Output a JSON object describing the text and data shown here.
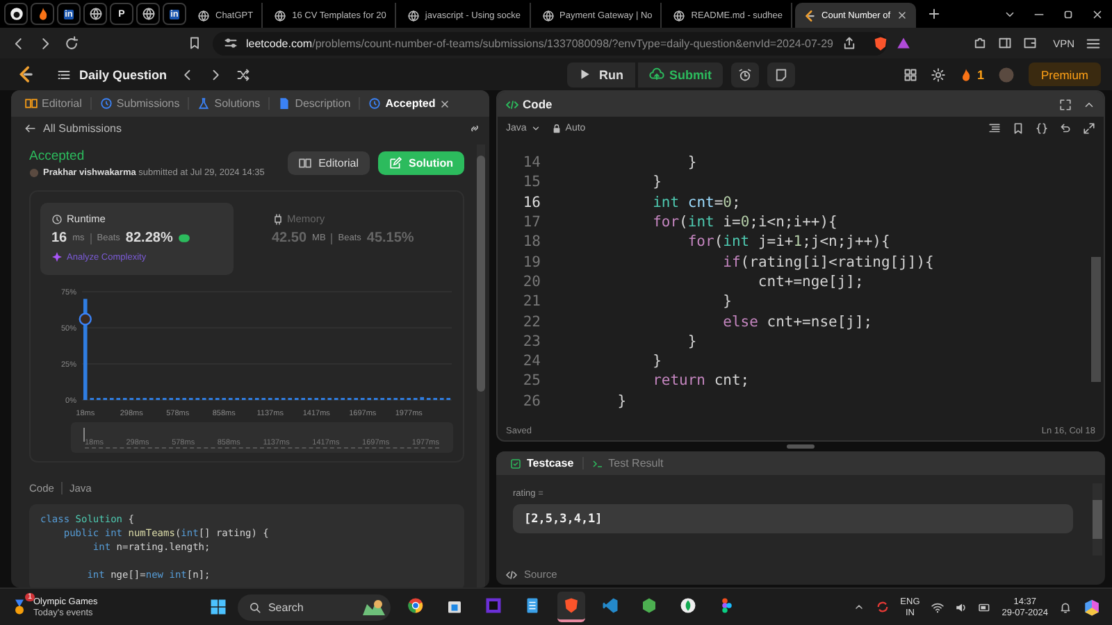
{
  "browser": {
    "pinned_tabs": [
      {
        "kind": "round"
      },
      {
        "kind": "flame"
      },
      {
        "kind": "badge",
        "glyph": "in"
      },
      {
        "kind": "globe"
      },
      {
        "kind": "letter",
        "glyph": "P"
      },
      {
        "kind": "globe"
      },
      {
        "kind": "badge",
        "glyph": "in"
      }
    ],
    "tabs": [
      {
        "title": "ChatGPT",
        "selected": false
      },
      {
        "title": "16 CV Templates for 20",
        "selected": false
      },
      {
        "title": "javascript - Using socke",
        "selected": false
      },
      {
        "title": "Payment Gateway | No",
        "selected": false
      },
      {
        "title": "README.md - sudhee",
        "selected": false
      },
      {
        "title": "Count Number of",
        "selected": true
      }
    ],
    "url": {
      "host": "leetcode.com",
      "path": "/problems/count-number-of-teams/submissions/1337080098/?envType=daily-question&envId=2024-07-29"
    },
    "vpn": "VPN"
  },
  "header": {
    "title": "Daily Question",
    "run": "Run",
    "submit": "Submit",
    "streak": "1",
    "premium": "Premium"
  },
  "left_panel": {
    "tabs": [
      {
        "label": "Editorial",
        "kind": "book",
        "selected": false
      },
      {
        "label": "Submissions",
        "kind": "clock",
        "selected": false
      },
      {
        "label": "Solutions",
        "kind": "flask",
        "selected": false
      },
      {
        "label": "Description",
        "kind": "doc",
        "selected": false
      },
      {
        "label": "Accepted",
        "kind": "clock",
        "selected": true
      }
    ],
    "back_link": "All Submissions",
    "submission": {
      "status": "Accepted",
      "byline": "**Prakhar vishwakarma** submitted at Jul 29, 2024 14:35",
      "editorial_button": "Editorial",
      "solution_button": "Solution"
    },
    "runtime": {
      "selected": true,
      "label": "Runtime",
      "value": "16",
      "unit": "ms",
      "beats_label": "Beats",
      "beats": "82.28%",
      "analyze": "Analyze Complexity"
    },
    "memory": {
      "selected": false,
      "label": "Memory",
      "value": "42.50",
      "unit": "MB",
      "beats_label": "Beats",
      "beats": "45.15%"
    },
    "chart_data": {
      "type": "bar",
      "ylim": [
        0,
        75
      ],
      "yticks": [
        {
          "value": 0,
          "label": "0%"
        },
        {
          "value": 25,
          "label": "25%"
        },
        {
          "value": 50,
          "label": "50%"
        },
        {
          "value": 75,
          "label": "75%"
        }
      ],
      "categories": [
        "18ms",
        null,
        null,
        null,
        null,
        null,
        null,
        "298ms",
        null,
        null,
        null,
        null,
        null,
        null,
        "578ms",
        null,
        null,
        null,
        null,
        null,
        null,
        "858ms",
        null,
        null,
        null,
        null,
        null,
        null,
        "1137ms",
        null,
        null,
        null,
        null,
        null,
        null,
        "1417ms",
        null,
        null,
        null,
        null,
        null,
        null,
        "1697ms",
        null,
        null,
        null,
        null,
        null,
        null,
        "1977ms",
        null,
        null,
        null,
        null,
        null,
        null
      ],
      "values": [
        70,
        1,
        1,
        1,
        1,
        1,
        1,
        1,
        1,
        1,
        1,
        1,
        1,
        1,
        1,
        1,
        1,
        1,
        1,
        1,
        1,
        1,
        1,
        1,
        1,
        1,
        1,
        1,
        1,
        1,
        1,
        1,
        1,
        1,
        1,
        1,
        1,
        1,
        1,
        1,
        1,
        1,
        1,
        1,
        1,
        1,
        1,
        1,
        1,
        1,
        1,
        2,
        1,
        1,
        1,
        1
      ]
    },
    "navigator_labels": [
      "18ms",
      "298ms",
      "578ms",
      "858ms",
      "1137ms",
      "1417ms",
      "1697ms",
      "1977ms"
    ],
    "code_header": {
      "title": "Code",
      "language": "Java"
    },
    "code_blocks": [
      {
        "lines": [
          {
            "tokens": [
              {
                "kind": "kw2",
                "text": "class"
              },
              {
                "kind": "cls",
                "text": " Solution"
              },
              {
                "kind": "p",
                "text": " {"
              }
            ]
          },
          {
            "tokens": [
              {
                "kind": "kw2",
                "text": "    public"
              },
              {
                "kind": "kw2",
                "text": " int"
              },
              {
                "kind": "fn",
                "text": " numTeams"
              },
              {
                "kind": "p",
                "text": "("
              },
              {
                "kind": "kw2",
                "text": "int"
              },
              {
                "kind": "p",
                "text": "[] rating) {"
              }
            ]
          },
          {
            "tokens": [
              {
                "kind": "kw2",
                "text": "         int"
              },
              {
                "kind": "p",
                "text": " n=rating.length;"
              }
            ]
          }
        ]
      },
      {
        "lines": [
          {
            "tokens": [
              {
                "kind": "kw2",
                "text": "        int"
              },
              {
                "kind": "p",
                "text": " nge[]="
              },
              {
                "kind": "kw2",
                "text": "new"
              },
              {
                "kind": "kw2",
                "text": " int"
              },
              {
                "kind": "p",
                "text": "[n];"
              }
            ]
          }
        ]
      }
    ]
  },
  "editor": {
    "title": "Code",
    "language": "Java",
    "mode": "Auto",
    "status": "Saved",
    "cursor": "Ln 16, Col 18",
    "lines": [
      {
        "number": "14",
        "active": false,
        "tokens": [
          {
            "kind": "p",
            "text": "            }"
          }
        ]
      },
      {
        "number": "15",
        "active": false,
        "tokens": [
          {
            "kind": "p",
            "text": "        }"
          }
        ]
      },
      {
        "number": "16",
        "active": true,
        "tokens": [
          {
            "kind": "type",
            "text": "        int"
          },
          {
            "kind": "var",
            "text": " cnt"
          },
          {
            "kind": "p",
            "text": "="
          },
          {
            "kind": "num",
            "text": "0"
          },
          {
            "kind": "p",
            "text": ";"
          }
        ]
      },
      {
        "number": "17",
        "active": false,
        "tokens": [
          {
            "kind": "kw",
            "text": "        for"
          },
          {
            "kind": "p",
            "text": "("
          },
          {
            "kind": "type",
            "text": "int"
          },
          {
            "kind": "p",
            "text": " i="
          },
          {
            "kind": "num",
            "text": "0"
          },
          {
            "kind": "p",
            "text": ";i<n;i++){"
          }
        ]
      },
      {
        "number": "18",
        "active": false,
        "tokens": [
          {
            "kind": "kw",
            "text": "            for"
          },
          {
            "kind": "p",
            "text": "("
          },
          {
            "kind": "type",
            "text": "int"
          },
          {
            "kind": "p",
            "text": " j=i+"
          },
          {
            "kind": "num",
            "text": "1"
          },
          {
            "kind": "p",
            "text": ";j<n;j++){"
          }
        ]
      },
      {
        "number": "19",
        "active": false,
        "tokens": [
          {
            "kind": "kw",
            "text": "                if"
          },
          {
            "kind": "p",
            "text": "(rating[i]<rating[j]){"
          }
        ]
      },
      {
        "number": "20",
        "active": false,
        "tokens": [
          {
            "kind": "p",
            "text": "                    cnt+=nge[j];"
          }
        ]
      },
      {
        "number": "21",
        "active": false,
        "tokens": [
          {
            "kind": "p",
            "text": "                }"
          }
        ]
      },
      {
        "number": "22",
        "active": false,
        "tokens": [
          {
            "kind": "kw",
            "text": "                else"
          },
          {
            "kind": "p",
            "text": " cnt+=nse[j];"
          }
        ]
      },
      {
        "number": "23",
        "active": false,
        "tokens": [
          {
            "kind": "p",
            "text": "            }"
          }
        ]
      },
      {
        "number": "24",
        "active": false,
        "tokens": [
          {
            "kind": "p",
            "text": "        }"
          }
        ]
      },
      {
        "number": "25",
        "active": false,
        "tokens": [
          {
            "kind": "kw",
            "text": "        return"
          },
          {
            "kind": "p",
            "text": " cnt;"
          }
        ]
      },
      {
        "number": "26",
        "active": false,
        "tokens": [
          {
            "kind": "p",
            "text": "    }"
          }
        ]
      }
    ]
  },
  "testcase": {
    "tabs": [
      {
        "label": "Testcase",
        "selected": true
      },
      {
        "label": "Test Result",
        "selected": false
      }
    ],
    "param": "rating =",
    "value": "[2,5,3,4,1]",
    "source": "Source"
  },
  "taskbar": {
    "news": {
      "title": "Olympic Games",
      "subtitle": "Today's events",
      "count": "1"
    },
    "search": {
      "placeholder": "Search"
    },
    "apps": [
      {
        "kind": "chrome",
        "active": false
      },
      {
        "kind": "store",
        "active": false
      },
      {
        "kind": "ide",
        "active": false
      },
      {
        "kind": "notepad",
        "active": false
      },
      {
        "kind": "brave",
        "active": true
      },
      {
        "kind": "vscode",
        "active": false
      },
      {
        "kind": "node",
        "active": false
      },
      {
        "kind": "leaf",
        "active": false
      },
      {
        "kind": "figma",
        "active": false
      }
    ],
    "lang": "ENG",
    "region": "IN",
    "time": "14:37",
    "date": "29-07-2024"
  }
}
